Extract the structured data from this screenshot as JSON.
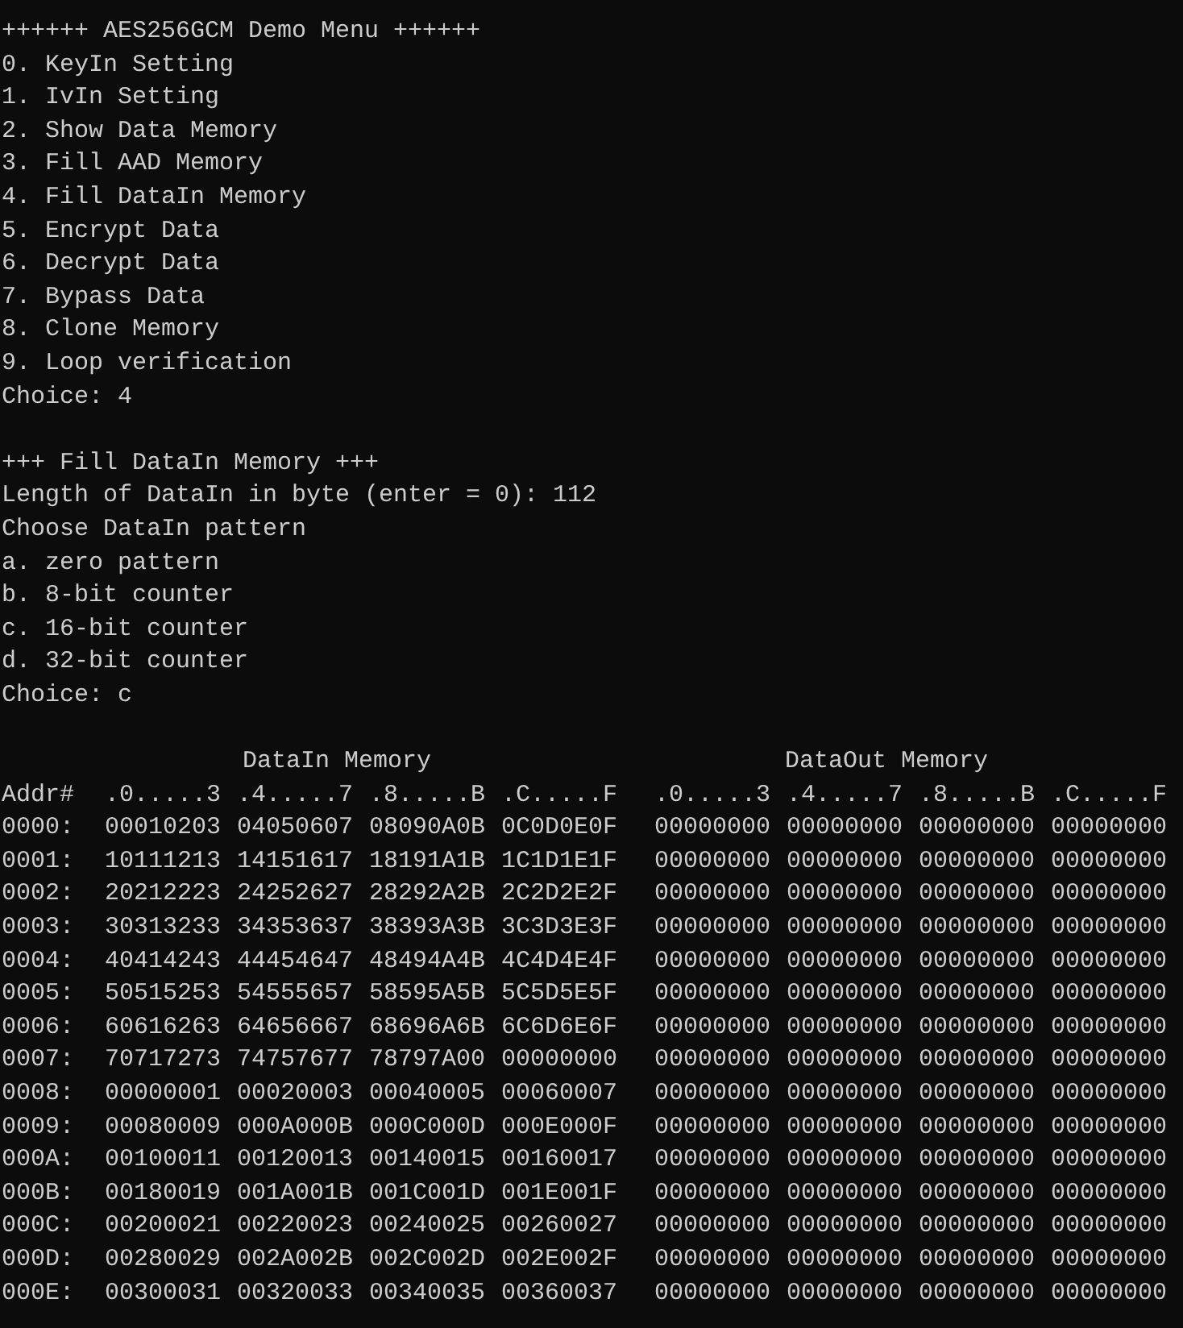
{
  "menu": {
    "title": "++++++ AES256GCM Demo Menu ++++++",
    "items": [
      "0. KeyIn Setting",
      "1. IvIn Setting",
      "2. Show Data Memory",
      "3. Fill AAD Memory",
      "4. Fill DataIn Memory",
      "5. Encrypt Data",
      "6. Decrypt Data",
      "7. Bypass Data",
      "8. Clone Memory",
      "9. Loop verification"
    ],
    "prompt": "Choice: 4"
  },
  "fill_section": {
    "title": "+++ Fill DataIn Memory +++",
    "lines": [
      "Length of DataIn in byte (enter = 0): 112",
      "Choose DataIn pattern"
    ],
    "options": [
      "a. zero pattern",
      "b. 8-bit counter",
      "c. 16-bit counter",
      "d. 32-bit counter"
    ],
    "prompt": "Choice: c"
  },
  "memory": {
    "data_in_title": "DataIn Memory",
    "data_out_title": "DataOut Memory",
    "addr_header": "Addr#",
    "data_in_columns": [
      ".0.....3",
      ".4.....7",
      ".8.....B",
      ".C.....F"
    ],
    "data_out_columns": [
      ".0.....3",
      ".4.....7",
      ".8.....B",
      ".C.....F"
    ],
    "rows": [
      {
        "addr": "0000:",
        "data_in": [
          "00010203",
          "04050607",
          "08090A0B",
          "0C0D0E0F"
        ],
        "data_out": [
          "00000000",
          "00000000",
          "00000000",
          "00000000"
        ]
      },
      {
        "addr": "0001:",
        "data_in": [
          "10111213",
          "14151617",
          "18191A1B",
          "1C1D1E1F"
        ],
        "data_out": [
          "00000000",
          "00000000",
          "00000000",
          "00000000"
        ]
      },
      {
        "addr": "0002:",
        "data_in": [
          "20212223",
          "24252627",
          "28292A2B",
          "2C2D2E2F"
        ],
        "data_out": [
          "00000000",
          "00000000",
          "00000000",
          "00000000"
        ]
      },
      {
        "addr": "0003:",
        "data_in": [
          "30313233",
          "34353637",
          "38393A3B",
          "3C3D3E3F"
        ],
        "data_out": [
          "00000000",
          "00000000",
          "00000000",
          "00000000"
        ]
      },
      {
        "addr": "0004:",
        "data_in": [
          "40414243",
          "44454647",
          "48494A4B",
          "4C4D4E4F"
        ],
        "data_out": [
          "00000000",
          "00000000",
          "00000000",
          "00000000"
        ]
      },
      {
        "addr": "0005:",
        "data_in": [
          "50515253",
          "54555657",
          "58595A5B",
          "5C5D5E5F"
        ],
        "data_out": [
          "00000000",
          "00000000",
          "00000000",
          "00000000"
        ]
      },
      {
        "addr": "0006:",
        "data_in": [
          "60616263",
          "64656667",
          "68696A6B",
          "6C6D6E6F"
        ],
        "data_out": [
          "00000000",
          "00000000",
          "00000000",
          "00000000"
        ]
      },
      {
        "addr": "0007:",
        "data_in": [
          "70717273",
          "74757677",
          "78797A00",
          "00000000"
        ],
        "data_out": [
          "00000000",
          "00000000",
          "00000000",
          "00000000"
        ]
      },
      {
        "addr": "0008:",
        "data_in": [
          "00000001",
          "00020003",
          "00040005",
          "00060007"
        ],
        "data_out": [
          "00000000",
          "00000000",
          "00000000",
          "00000000"
        ]
      },
      {
        "addr": "0009:",
        "data_in": [
          "00080009",
          "000A000B",
          "000C000D",
          "000E000F"
        ],
        "data_out": [
          "00000000",
          "00000000",
          "00000000",
          "00000000"
        ]
      },
      {
        "addr": "000A:",
        "data_in": [
          "00100011",
          "00120013",
          "00140015",
          "00160017"
        ],
        "data_out": [
          "00000000",
          "00000000",
          "00000000",
          "00000000"
        ]
      },
      {
        "addr": "000B:",
        "data_in": [
          "00180019",
          "001A001B",
          "001C001D",
          "001E001F"
        ],
        "data_out": [
          "00000000",
          "00000000",
          "00000000",
          "00000000"
        ]
      },
      {
        "addr": "000C:",
        "data_in": [
          "00200021",
          "00220023",
          "00240025",
          "00260027"
        ],
        "data_out": [
          "00000000",
          "00000000",
          "00000000",
          "00000000"
        ]
      },
      {
        "addr": "000D:",
        "data_in": [
          "00280029",
          "002A002B",
          "002C002D",
          "002E002F"
        ],
        "data_out": [
          "00000000",
          "00000000",
          "00000000",
          "00000000"
        ]
      },
      {
        "addr": "000E:",
        "data_in": [
          "00300031",
          "00320033",
          "00340035",
          "00360037"
        ],
        "data_out": [
          "00000000",
          "00000000",
          "00000000",
          "00000000"
        ]
      }
    ]
  }
}
